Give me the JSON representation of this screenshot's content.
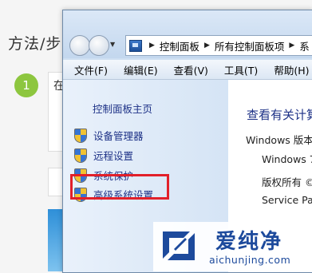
{
  "article": {
    "heading": "方法/步",
    "step_number": "1",
    "box_text": "在"
  },
  "window": {
    "address_bar": {
      "crumbs": [
        "控制面板",
        "所有控制面板项",
        "系"
      ]
    },
    "menu": [
      "文件(F)",
      "编辑(E)",
      "查看(V)",
      "工具(T)",
      "帮助(H)"
    ],
    "sidebar": {
      "home_link": "控制面板主页",
      "links": [
        "设备管理器",
        "远程设置",
        "系统保护",
        "高级系统设置"
      ],
      "highlighted": "高级系统设置"
    },
    "content": {
      "title": "查看有关计算",
      "edition_label": "Windows 版本",
      "lines": [
        "Windows 7",
        "版权所有 ©",
        "Service Pac"
      ]
    }
  },
  "watermark": {
    "name": "爱纯净",
    "url": "aichunjing.com"
  },
  "colors": {
    "link": "#1e3287",
    "highlight_border": "#e2202a",
    "step_badge": "#8dc63f",
    "watermark": "#1d4a9c"
  }
}
